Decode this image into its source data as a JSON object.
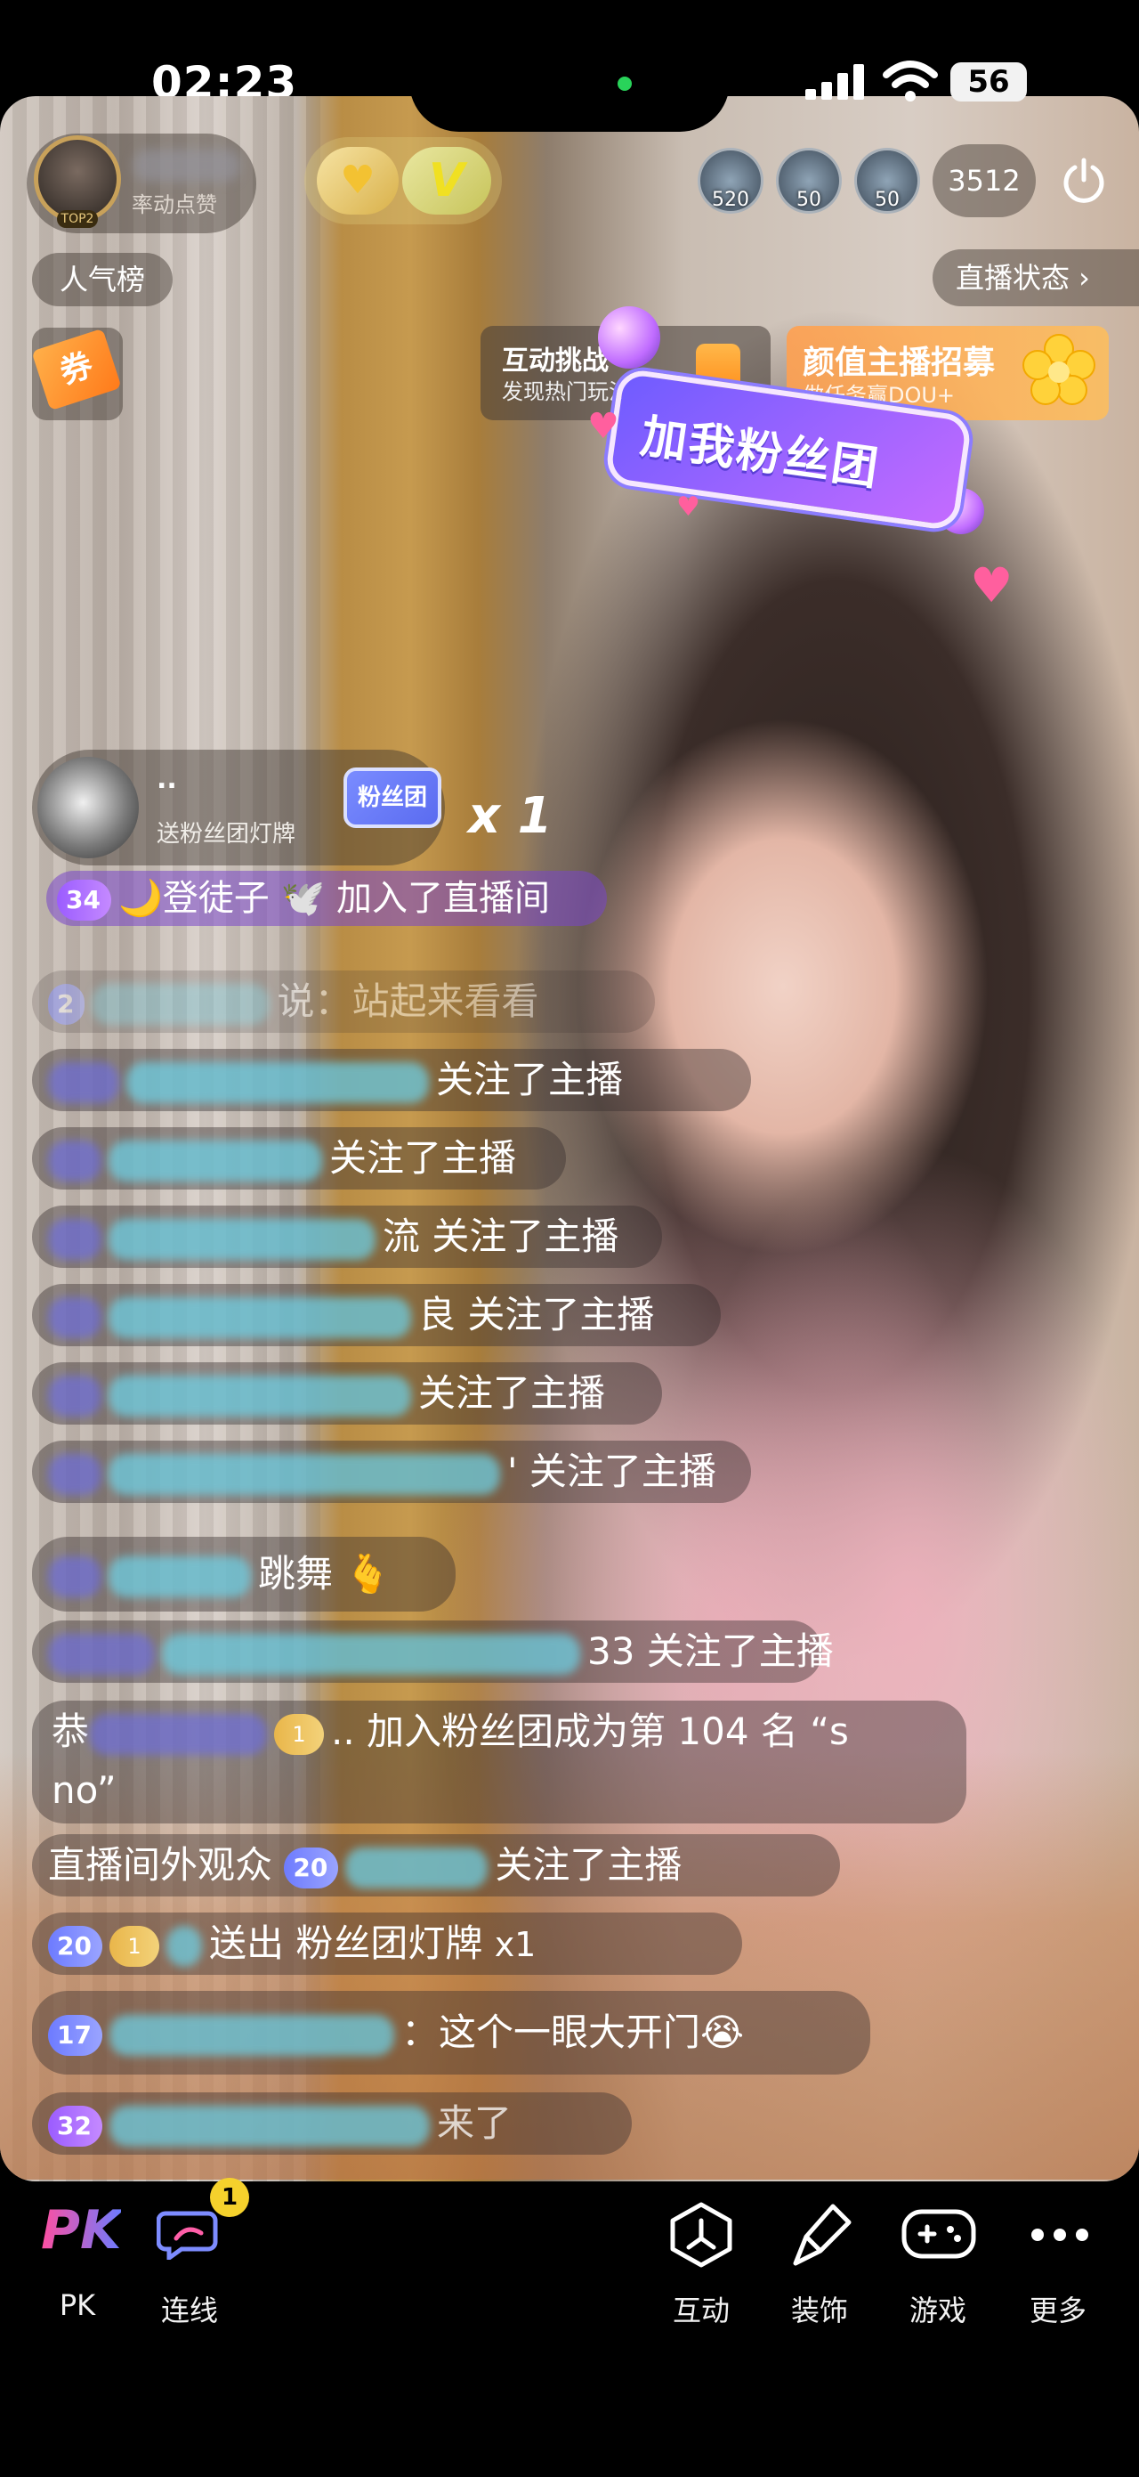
{
  "status_bar": {
    "time": "02:23",
    "battery": "56"
  },
  "header": {
    "host_badge": "TOP2",
    "host_subtitle": "率动点赞",
    "viewers": [
      {
        "count": "520"
      },
      {
        "count": "50"
      },
      {
        "count": "50"
      }
    ],
    "online_count": "3512"
  },
  "left_controls": {
    "rank_label": "人气榜",
    "coupon_label": "券"
  },
  "right_controls": {
    "status_label": "直播状态 ›"
  },
  "banners": {
    "challenge_title": "互动挑战",
    "challenge_sub": "发现热门玩法",
    "recruit_title": "颜值主播招募",
    "recruit_sub": "做任务赢DOU+",
    "join_fan_text": "加我粉丝团"
  },
  "gift_notice": {
    "user": "..",
    "desc": "送粉丝团灯牌",
    "badge": "粉丝团",
    "count": "x 1"
  },
  "join_message": {
    "level": "34",
    "text": "🌙登徒子 🕊️ 加入了直播间"
  },
  "chat": [
    {
      "level": "2",
      "text": "说：站起来看看"
    },
    {
      "text": "关注了主播"
    },
    {
      "text": "关注了主播"
    },
    {
      "text": "流 关注了主播"
    },
    {
      "text": "良 关注了主播"
    },
    {
      "text": "关注了主播"
    },
    {
      "text": "' 关注了主播"
    },
    {
      "text": "跳舞 🫰"
    },
    {
      "text": "33 关注了主播"
    },
    {
      "text_1": "恭",
      "text_2": ".. 加入粉丝团成为第 104 名 “s",
      "text_3": "no”"
    },
    {
      "prefix": "直播间外观众",
      "level": "20",
      "text": "关注了主播"
    },
    {
      "level": "20",
      "text": "送出 粉丝团灯牌",
      "suffix": "x1"
    },
    {
      "level": "17",
      "text": "：这个一眼大开门😭"
    },
    {
      "level": "32",
      "text": "来了"
    }
  ],
  "bottom_nav": [
    {
      "icon": "PK",
      "label": "PK"
    },
    {
      "icon": "连线",
      "label": "连线",
      "badge": "1"
    },
    {
      "icon": "互动",
      "label": "互动"
    },
    {
      "icon": "装饰",
      "label": "装饰"
    },
    {
      "icon": "游戏",
      "label": "游戏"
    },
    {
      "icon": "更多",
      "label": "更多"
    }
  ],
  "colors": {
    "accent_blue": "#6d7bff",
    "accent_purple": "#9b5cff",
    "recruit_orange": "#ffa050",
    "online_dot": "#29d35a"
  }
}
